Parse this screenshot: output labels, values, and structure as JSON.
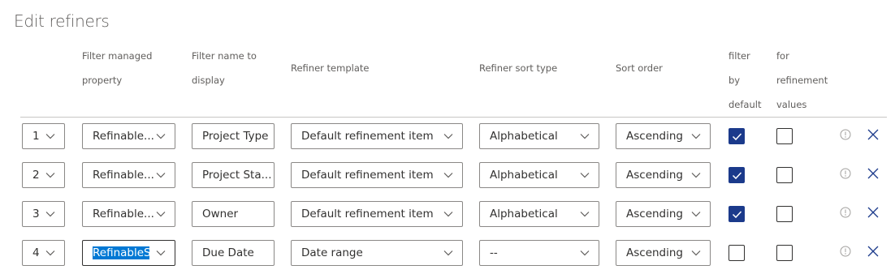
{
  "page": {
    "title": "Edit refiners"
  },
  "columns": {
    "managed_line1": "Filter managed",
    "managed_line2": "property",
    "display_line1": "Filter name to",
    "display_line2": "display",
    "template": "Refiner template",
    "sort_type": "Refiner sort type",
    "sort_order": "Sort order",
    "filter_line1": "filter",
    "filter_line2": "by",
    "filter_line3": "default",
    "refine_line1": "for",
    "refine_line2": "refinement",
    "refine_line3": "values"
  },
  "rows": [
    {
      "order": "1",
      "managed": "Refinable...",
      "display": "Project Type",
      "template": "Default refinement item",
      "sort_type": "Alphabetical",
      "sort_order": "Ascending",
      "filter_by_default": true,
      "for_refinement_values": false
    },
    {
      "order": "2",
      "managed": "Refinable...",
      "display": "Project Sta...",
      "template": "Default refinement item",
      "sort_type": "Alphabetical",
      "sort_order": "Ascending",
      "filter_by_default": true,
      "for_refinement_values": false
    },
    {
      "order": "3",
      "managed": "Refinable...",
      "display": "Owner",
      "template": "Default refinement item",
      "sort_type": "Alphabetical",
      "sort_order": "Ascending",
      "filter_by_default": true,
      "for_refinement_values": false
    },
    {
      "order": "4",
      "managed": "RefinableSt",
      "display": "Due Date",
      "template": "Date range",
      "sort_type": "--",
      "sort_order": "Ascending",
      "filter_by_default": false,
      "for_refinement_values": false
    }
  ],
  "colors": {
    "accent": "#1b3a8b",
    "highlight": "#0078d4",
    "border": "#8a8886"
  },
  "icons": {
    "chevron": "chevron-down-icon",
    "info": "info-icon",
    "delete": "close-icon"
  }
}
